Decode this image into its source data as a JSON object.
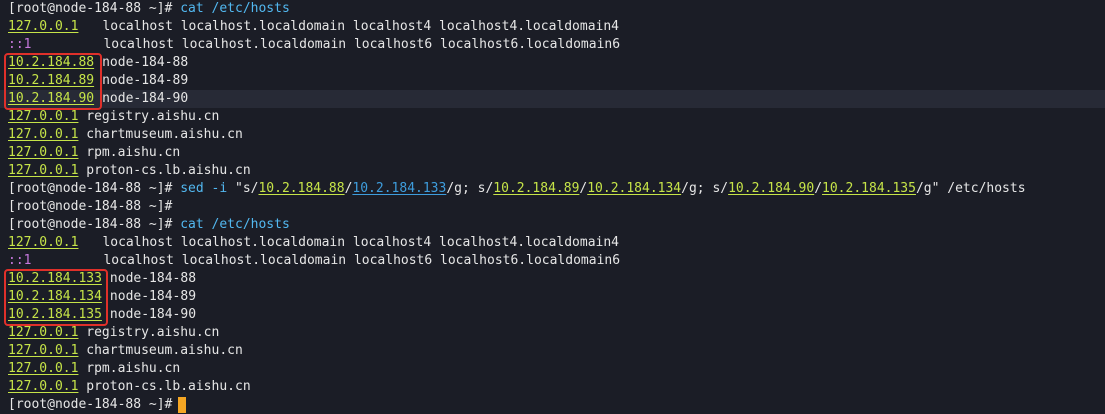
{
  "prompt": "[root@node-184-88 ~]#",
  "cmd_cat": "cat /etc/hosts",
  "block1": {
    "lo4_ip": "127.0.0.1",
    "lo4_names": "localhost localhost.localdomain localhost4 localhost4.localdomain4",
    "lo6_ip": "::1",
    "lo6_names": "localhost localhost.localdomain localhost6 localhost6.localdomain6",
    "node88_ip": "10.2.184.88",
    "node88_name": "node-184-88",
    "node89_ip": "10.2.184.89",
    "node89_name": "node-184-89",
    "node90_ip": "10.2.184.90",
    "node90_name": "node-184-90",
    "reg_ip": "127.0.0.1",
    "reg_name": "registry.aishu.cn",
    "chart_ip": "127.0.0.1",
    "chart_name": "chartmuseum.aishu.cn",
    "rpm_ip": "127.0.0.1",
    "rpm_name": "rpm.aishu.cn",
    "proton_ip": "127.0.0.1",
    "proton_name": "proton-cs.lb.aishu.cn"
  },
  "sed": {
    "cmd": "sed -i",
    "q_open": "\"s/",
    "old1": "10.2.184.88",
    "slash1": "/",
    "new1": "10.2.184.133",
    "mid1": "/g; s/",
    "old2": "10.2.184.89",
    "slash2": "/",
    "new2": "10.2.184.134",
    "mid2": "/g; s/",
    "old3": "10.2.184.90",
    "slash3": "/",
    "new3": "10.2.184.135",
    "tail": "/g\" /etc/hosts"
  },
  "block2": {
    "lo4_ip": "127.0.0.1",
    "lo4_names": "localhost localhost.localdomain localhost4 localhost4.localdomain4",
    "lo6_ip": "::1",
    "lo6_names": "localhost localhost.localdomain localhost6 localhost6.localdomain6",
    "node88_ip": "10.2.184.133",
    "node88_name": "node-184-88",
    "node89_ip": "10.2.184.134",
    "node89_name": "node-184-89",
    "node90_ip": "10.2.184.135",
    "node90_name": "node-184-90",
    "reg_ip": "127.0.0.1",
    "reg_name": "registry.aishu.cn",
    "chart_ip": "127.0.0.1",
    "chart_name": "chartmuseum.aishu.cn",
    "rpm_ip": "127.0.0.1",
    "rpm_name": "rpm.aishu.cn",
    "proton_ip": "127.0.0.1",
    "proton_name": "proton-cs.lb.aishu.cn"
  },
  "colors": {
    "background": "#1b1d26",
    "ip_green": "#c6e448",
    "command_blue": "#52b8f0",
    "ipv6_purple": "#c678dd",
    "highlight_box_red": "#e0302a",
    "cursor_orange": "#f5a623"
  }
}
